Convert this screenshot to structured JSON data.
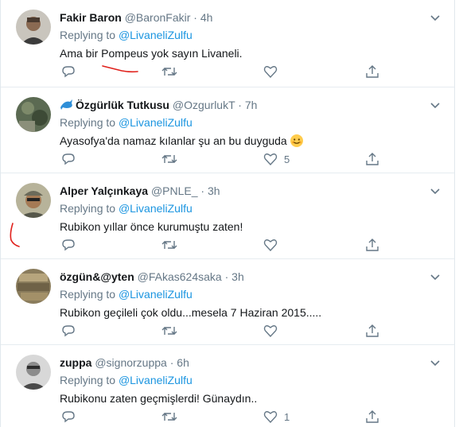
{
  "tweets": [
    {
      "name": "Fakir Baron",
      "handle": "@BaronFakir",
      "separator": "·",
      "time": "4h",
      "replying_prefix": "Replying to",
      "replying_to": "@LivaneliZulfu",
      "text": "Ama bir Pompeus yok sayın Livaneli.",
      "like_count": ""
    },
    {
      "name": "Özgürlük Tutkusu",
      "handle": "@OzgurlukT",
      "separator": "·",
      "time": "7h",
      "replying_prefix": "Replying to",
      "replying_to": "@LivaneliZulfu",
      "text": "Ayasofya'da namaz kılanlar şu an bu duyguda",
      "like_count": "5"
    },
    {
      "name": "Alper Yalçınkaya",
      "handle": "@PNLE_",
      "separator": "·",
      "time": "3h",
      "replying_prefix": "Replying to",
      "replying_to": "@LivaneliZulfu",
      "text": "Rubikon yıllar önce kurumuştu zaten!",
      "like_count": ""
    },
    {
      "name": "özgün&@yten",
      "handle": "@FAkas624saka",
      "separator": "·",
      "time": "3h",
      "replying_prefix": "Replying to",
      "replying_to": "@LivaneliZulfu",
      "text": "Rubikon geçileli çok oldu...mesela 7 Haziran 2015.....",
      "like_count": ""
    },
    {
      "name": "zuppa",
      "handle": "@signorzuppa",
      "separator": "·",
      "time": "6h",
      "replying_prefix": "Replying to",
      "replying_to": "@LivaneliZulfu",
      "text": "Rubikonu zaten geçmişlerdi! Günaydın..",
      "like_count": "1"
    }
  ],
  "colors": {
    "link": "#1b95e0",
    "muted": "#657786",
    "text": "#14171a",
    "annotation": "#e0201b"
  },
  "icons": [
    "reply-icon",
    "retweet-icon",
    "like-icon",
    "share-icon",
    "chevron-down-icon",
    "dolphin-icon",
    "smiling-face-emoji"
  ]
}
